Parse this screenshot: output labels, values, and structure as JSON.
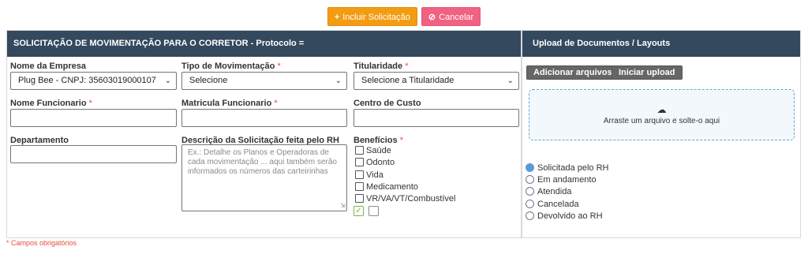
{
  "toolbar": {
    "include_label": "Incluir Solicitação",
    "include_icon": "plus-icon",
    "cancel_label": "Cancelar",
    "cancel_icon": "ban-icon",
    "colors": {
      "include": "#f39c12",
      "cancel": "#f06281"
    }
  },
  "form": {
    "header": "SOLICITAÇÃO DE MOVIMENTAÇÃO PARA O CORRETOR - Protocolo =",
    "empresa": {
      "label": "Nome da Empresa",
      "value": "Plug Bee - CNPJ: 35603019000107"
    },
    "tipo": {
      "label": "Tipo de Movimentação",
      "required": "*",
      "value": "Selecione"
    },
    "titularidade": {
      "label": "Titularidade",
      "required": "*",
      "value": "Selecione a Titularidade"
    },
    "funcionario": {
      "label": "Nome Funcionario",
      "required": "*",
      "value": ""
    },
    "matricula": {
      "label": "Matricula Funcionario",
      "required": "*",
      "value": ""
    },
    "centro": {
      "label": "Centro de Custo",
      "value": ""
    },
    "departamento": {
      "label": "Departamento",
      "value": ""
    },
    "descricao": {
      "label": "Descrição da Solicitação feita pelo RH",
      "placeholder": "Ex.: Detalhe os Planos e Operadoras de cada movimentação ... aqui também serão informados os números das carteirinhas"
    },
    "beneficios": {
      "label": "Benefícios",
      "required": "*",
      "options": [
        "Saúde",
        "Odonto",
        "Vida",
        "Medicamento",
        "VR/VA/VT/Combustível"
      ]
    },
    "required_note": "* Campos obrigatórios"
  },
  "upload": {
    "header": "Upload de Documentos / Layouts",
    "add_label": "Adicionar arquivos",
    "start_label": "Iniciar upload",
    "dropzone_icon": "cloud-upload-icon",
    "dropzone_text": "Arraste um arquivo e solte-o aqui",
    "status_options": [
      "Solicitada pelo RH",
      "Em andamento",
      "Atendida",
      "Cancelada",
      "Devolvido ao RH"
    ],
    "status_selected": "Solicitada pelo RH"
  },
  "colors": {
    "header_bg": "#34495e",
    "required": "#e74c3c",
    "radio_selected": "#5b9bd5"
  }
}
